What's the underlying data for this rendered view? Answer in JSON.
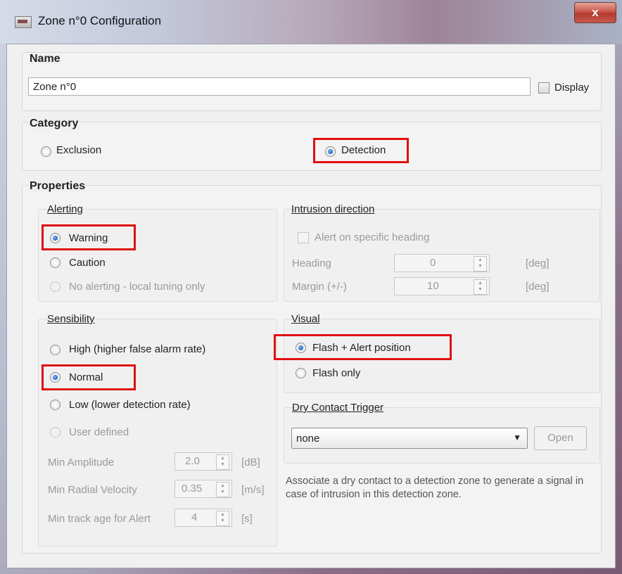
{
  "window": {
    "title": "Zone n°0 Configuration",
    "close_glyph": "x"
  },
  "name_group": {
    "title": "Name",
    "value": "Zone n°0",
    "display_label": "Display",
    "display_checked": false
  },
  "category": {
    "title": "Category",
    "exclusion_label": "Exclusion",
    "detection_label": "Detection",
    "selected": "Detection"
  },
  "properties": {
    "title": "Properties",
    "alerting": {
      "title": "Alerting",
      "options": [
        {
          "label": "Warning",
          "checked": true,
          "enabled": true
        },
        {
          "label": "Caution",
          "checked": false,
          "enabled": true
        },
        {
          "label": "No alerting - local tuning only",
          "checked": false,
          "enabled": false
        }
      ]
    },
    "intrusion_direction": {
      "title": "Intrusion direction",
      "specific_heading_label": "Alert on specific heading",
      "heading_label": "Heading",
      "heading_value": "0",
      "heading_unit": "[deg]",
      "margin_label": "Margin (+/-)",
      "margin_value": "10",
      "margin_unit": "[deg]"
    },
    "sensibility": {
      "title": "Sensibility",
      "options": [
        {
          "label": "High (higher false alarm rate)",
          "checked": false,
          "enabled": true
        },
        {
          "label": "Normal",
          "checked": true,
          "enabled": true
        },
        {
          "label": "Low (lower detection rate)",
          "checked": false,
          "enabled": true
        },
        {
          "label": "User defined",
          "checked": false,
          "enabled": false
        }
      ],
      "min_amplitude_label": "Min Amplitude",
      "min_amplitude_value": "2.0",
      "min_amplitude_unit": "[dB]",
      "min_radial_velocity_label": "Min Radial Velocity",
      "min_radial_velocity_value": "0.35",
      "min_radial_velocity_unit": "[m/s]",
      "min_track_age_label": "Min track age for Alert",
      "min_track_age_value": "4",
      "min_track_age_unit": "[s]"
    },
    "visual": {
      "title": "Visual",
      "options": [
        {
          "label": "Flash + Alert position",
          "checked": true
        },
        {
          "label": "Flash only",
          "checked": false
        }
      ]
    },
    "dry_contact": {
      "title": "Dry Contact Trigger",
      "selected": "none",
      "open_label": "Open",
      "description": "Associate a dry contact to a detection zone to generate a signal in case of intrusion in this detection zone."
    }
  },
  "colors": {
    "highlight": "#e01010",
    "accent": "#1e62c4"
  }
}
